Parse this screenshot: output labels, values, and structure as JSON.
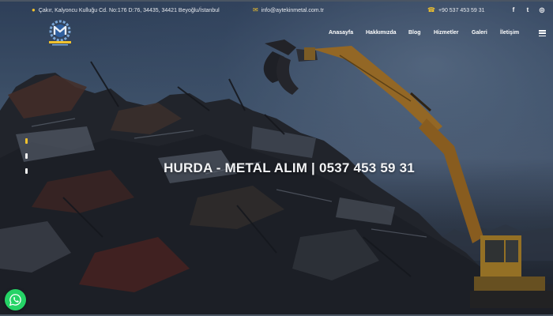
{
  "topbar": {
    "address": "Çakır, Kalyoncu Kulluğu Cd. No:176 D:76, 34435, 34421 Beyoğlu/İstanbul",
    "email": "info@aytekinmetal.com.tr",
    "phone": "+90 537 453 59 31",
    "social": [
      {
        "name": "facebook",
        "glyph": "f"
      },
      {
        "name": "twitter",
        "glyph": "t"
      },
      {
        "name": "instagram",
        "glyph": "◎"
      }
    ]
  },
  "logo": {
    "text": "AYTEKIN METAL",
    "icon": "gear-m-logo"
  },
  "nav": {
    "items": [
      "Anasayfa",
      "Hakkımızda",
      "Blog",
      "Hizmetler",
      "Galeri",
      "İletişim"
    ],
    "menu_icon": "hamburger-icon"
  },
  "hero": {
    "title": "HURDA - METAL ALIM | 0537 453 59 31",
    "slides_total": 3,
    "slide_active": 1
  },
  "whatsapp": {
    "icon": "whatsapp-icon"
  },
  "colors": {
    "accent": "#f1c22e",
    "whatsapp": "#25d366",
    "text": "#ffffff"
  }
}
